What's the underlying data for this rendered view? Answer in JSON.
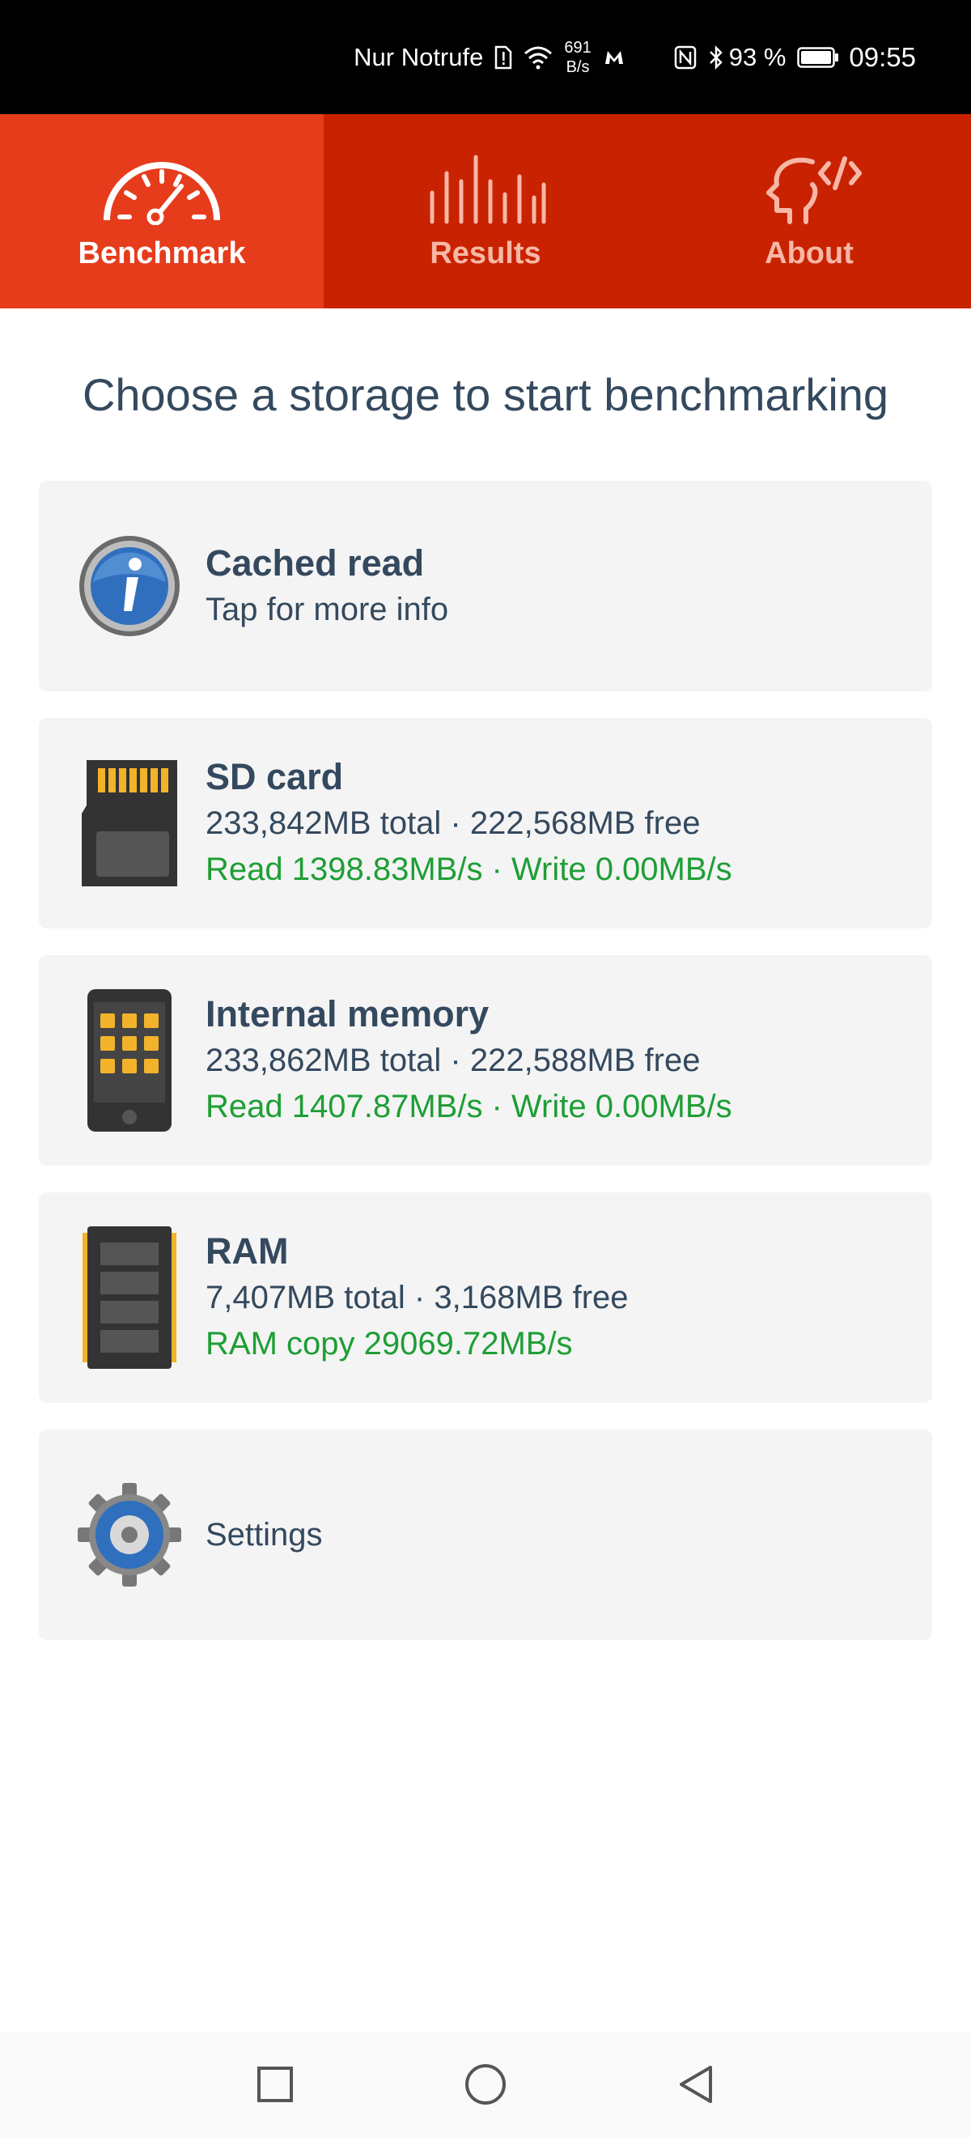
{
  "status_bar": {
    "carrier_text": "Nur Notrufe",
    "net_speed_value": "691",
    "net_speed_unit": "B/s",
    "battery_percent": "93 %",
    "time": "09:55"
  },
  "tabs": [
    {
      "label": "Benchmark",
      "icon": "speedometer-icon",
      "active": true
    },
    {
      "label": "Results",
      "icon": "bars-icon",
      "active": false
    },
    {
      "label": "About",
      "icon": "head-code-icon",
      "active": false
    }
  ],
  "heading": "Choose a storage to start benchmarking",
  "cards": {
    "cached_read": {
      "title": "Cached read",
      "subtitle": "Tap for more info",
      "icon": "info-icon"
    },
    "sd_card": {
      "title": "SD card",
      "capacity": "233,842MB total · 222,568MB free",
      "speed": "Read 1398.83MB/s · Write 0.00MB/s",
      "icon": "sd-card-icon"
    },
    "internal_memory": {
      "title": "Internal memory",
      "capacity": "233,862MB total · 222,588MB free",
      "speed": "Read 1407.87MB/s · Write 0.00MB/s",
      "icon": "phone-icon"
    },
    "ram": {
      "title": "RAM",
      "capacity": "7,407MB total · 3,168MB free",
      "speed": "RAM copy 29069.72MB/s",
      "icon": "ram-chip-icon"
    },
    "settings": {
      "label": "Settings",
      "icon": "gear-icon"
    }
  },
  "colors": {
    "tab_active": "#e63c1c",
    "tab_inactive": "#c92200",
    "text_primary": "#34495e",
    "speed_green": "#1e9e35",
    "card_bg": "#f4f4f4"
  }
}
